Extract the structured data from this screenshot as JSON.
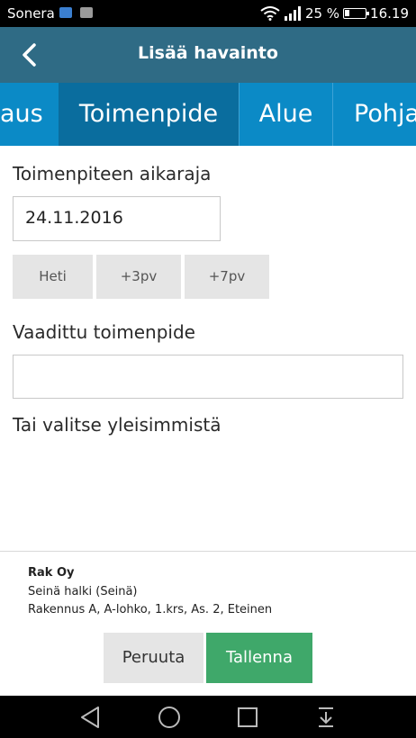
{
  "status_bar": {
    "carrier": "Sonera",
    "battery_text": "25 %",
    "battery_level": 0.25,
    "time": "16.19"
  },
  "header": {
    "title": "Lisää havainto"
  },
  "tabs": [
    {
      "label": "aus",
      "active": false
    },
    {
      "label": "Toimenpide",
      "active": true
    },
    {
      "label": "Alue",
      "active": false
    },
    {
      "label": "Pohja",
      "active": false
    }
  ],
  "form": {
    "deadline_label": "Toimenpiteen aikaraja",
    "deadline_value": "24.11.2016",
    "quick_buttons": [
      "Heti",
      "+3pv",
      "+7pv"
    ],
    "required_action_label": "Vaadittu toimenpide",
    "required_action_value": "",
    "common_label": "Tai valitse yleisimmistä"
  },
  "details": {
    "company": "Rak Oy",
    "observation": "Seinä halki (Seinä)",
    "location": "Rakennus A,  A-lohko, 1.krs,  As. 2,  Eteinen"
  },
  "actions": {
    "cancel": "Peruuta",
    "save": "Tallenna"
  },
  "colors": {
    "app_bar": "#2f6b85",
    "tab_bar": "#0b8ac6",
    "tab_active": "#0a6d9e",
    "save": "#3fa86a"
  }
}
